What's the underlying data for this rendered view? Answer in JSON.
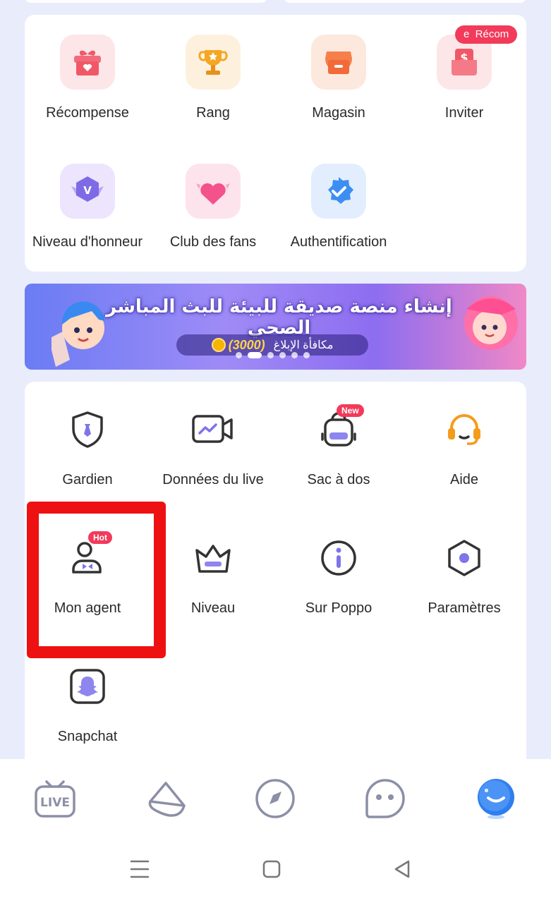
{
  "grid1": {
    "items": [
      {
        "label": "Récompense",
        "icon": "gift-icon"
      },
      {
        "label": "Rang",
        "icon": "trophy-icon"
      },
      {
        "label": "Magasin",
        "icon": "store-icon"
      },
      {
        "label": "Inviter",
        "icon": "invite-icon",
        "badge": "e  Récom"
      },
      {
        "label": "Niveau d'honneur",
        "icon": "honor-badge-icon"
      },
      {
        "label": "Club des fans",
        "icon": "heart-icon"
      },
      {
        "label": "Authentification",
        "icon": "verified-icon"
      }
    ]
  },
  "banner": {
    "title": "إنشاء منصة صديقة للبيئة للبث المباشر الصحي",
    "reward_label": "مكافأة الإبلاغ",
    "reward_value": "(3000)",
    "slide_count": 6,
    "active_slide": 1
  },
  "grid2": {
    "items": [
      {
        "label": "Gardien",
        "icon": "shield-icon"
      },
      {
        "label": "Données du live",
        "icon": "video-camera-icon"
      },
      {
        "label": "Sac à dos",
        "icon": "backpack-icon",
        "badge": "New"
      },
      {
        "label": "Aide",
        "icon": "headset-icon"
      },
      {
        "label": "Mon agent",
        "icon": "agent-icon",
        "badge": "Hot"
      },
      {
        "label": "Niveau",
        "icon": "crown-icon"
      },
      {
        "label": "Sur Poppo",
        "icon": "info-icon"
      },
      {
        "label": "Paramètres",
        "icon": "settings-hexagon-icon"
      },
      {
        "label": "Snapchat",
        "icon": "snapchat-icon"
      }
    ]
  },
  "bottom_nav": {
    "items": [
      {
        "label": "LIVE",
        "icon": "live-tv-icon"
      },
      {
        "icon": "party-cup-icon"
      },
      {
        "icon": "compass-icon"
      },
      {
        "icon": "chat-bubble-icon"
      },
      {
        "icon": "profile-blob-icon",
        "active": true
      }
    ]
  },
  "colors": {
    "background": "#e8ecfb",
    "highlight": "#ee1111",
    "badge": "#f23a5a",
    "accent_purple": "#7f74e8"
  }
}
